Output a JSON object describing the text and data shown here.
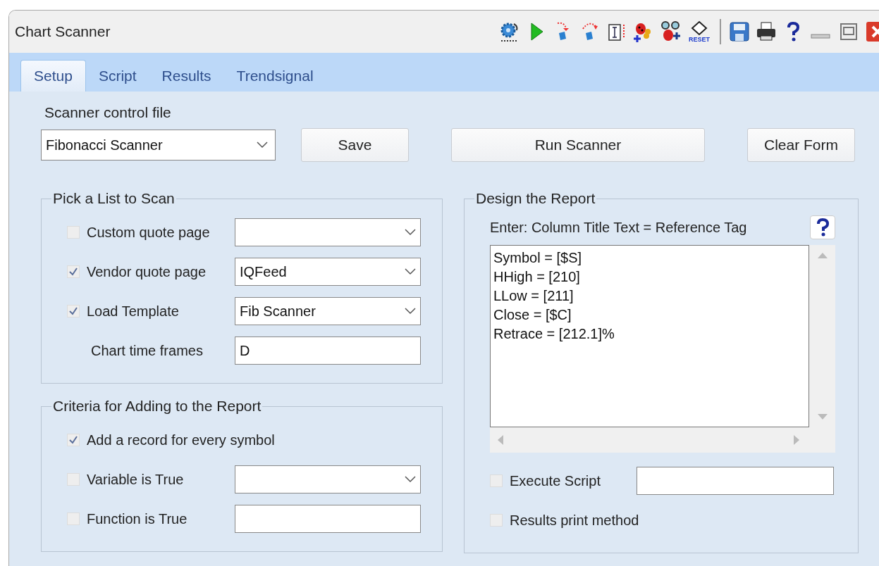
{
  "window": {
    "title": "Chart Scanner"
  },
  "toolbar": {
    "reset_label": "RESET"
  },
  "tabs": [
    {
      "label": "Setup",
      "selected": true
    },
    {
      "label": "Script",
      "selected": false
    },
    {
      "label": "Results",
      "selected": false
    },
    {
      "label": "Trendsignal",
      "selected": false
    }
  ],
  "control_file": {
    "label": "Scanner control file",
    "value": "Fibonacci Scanner"
  },
  "buttons": [
    "Save",
    "Run Scanner",
    "Clear Form"
  ],
  "pick_list": {
    "title": "Pick a List to Scan",
    "rows": [
      {
        "kind": "check-dropdown",
        "label": "Custom quote page",
        "checked": false
      },
      {
        "kind": "check-dropdown",
        "label": "Vendor quote page",
        "checked": true,
        "value": "IQFeed"
      },
      {
        "kind": "check-dropdown",
        "label": "Load Template",
        "checked": true,
        "value": "Fib Scanner"
      },
      {
        "kind": "label-input",
        "label": "Chart time frames",
        "value": "D"
      }
    ]
  },
  "criteria": {
    "title": "Criteria for Adding to the Report",
    "rows": [
      {
        "kind": "check",
        "label": "Add a record for every symbol",
        "checked": true
      },
      {
        "kind": "check-dropdown",
        "label": "Variable is True",
        "checked": false
      },
      {
        "kind": "check-input",
        "label": "Function is True",
        "checked": false
      }
    ]
  },
  "report": {
    "title": "Design the Report",
    "hint": "Enter:  Column Title Text = Reference Tag",
    "lines": [
      "Symbol = [$S]",
      "HHigh = [210]",
      "LLow = [211]",
      "Close = [$C]",
      "Retrace = [212.1]%"
    ],
    "options": [
      {
        "kind": "check-input",
        "label": "Execute Script",
        "checked": false
      },
      {
        "kind": "check",
        "label": "Results print method",
        "checked": false
      }
    ]
  }
}
